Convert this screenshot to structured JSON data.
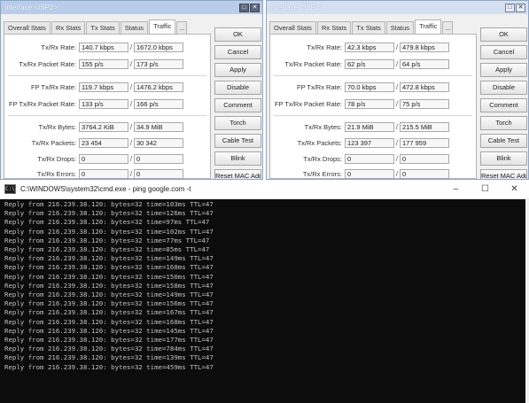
{
  "left_window": {
    "title": "Interface <ISP2>",
    "tabs": [
      "Overall Stats",
      "Rx Stats",
      "Tx Stats",
      "Status",
      "Traffic",
      "..."
    ],
    "active_tab": "Traffic",
    "rows": [
      {
        "label": "Tx/Rx Rate:",
        "v1": "140.7 kbps",
        "v2": "1672.0 kbps"
      },
      {
        "label": "Tx/Rx Packet Rate:",
        "v1": "155 p/s",
        "v2": "173 p/s"
      },
      {
        "label": "FP Tx/Rx Rate:",
        "v1": "119.7 kbps",
        "v2": "1476.2 kbps"
      },
      {
        "label": "FP Tx/Rx Packet Rate:",
        "v1": "133 p/s",
        "v2": "166 p/s"
      },
      {
        "label": "Tx/Rx Bytes:",
        "v1": "3764.2 KiB",
        "v2": "34.9 MiB"
      },
      {
        "label": "Tx/Rx Packets:",
        "v1": "23 454",
        "v2": "30 342"
      },
      {
        "label": "Tx/Rx Drops:",
        "v1": "0",
        "v2": "0"
      },
      {
        "label": "Tx/Rx Errors:",
        "v1": "0",
        "v2": "0"
      }
    ],
    "buttons": [
      "OK",
      "Cancel",
      "Apply",
      "Disable",
      "Comment",
      "Torch",
      "Cable Test",
      "Blink",
      "Reset MAC Address"
    ]
  },
  "right_window": {
    "title": "Interface <ISP1>",
    "tabs": [
      "Overall Stats",
      "Rx Stats",
      "Tx Stats",
      "Status",
      "Traffic",
      "..."
    ],
    "active_tab": "Traffic",
    "rows": [
      {
        "label": "Tx/Rx Rate:",
        "v1": "42.3 kbps",
        "v2": "479.8 kbps"
      },
      {
        "label": "Tx/Rx Packet Rate:",
        "v1": "62 p/s",
        "v2": "64 p/s"
      },
      {
        "label": "FP Tx/Rx Rate:",
        "v1": "70.0 kbps",
        "v2": "472.8 kbps"
      },
      {
        "label": "FP Tx/Rx Packet Rate:",
        "v1": "78 p/s",
        "v2": "75 p/s"
      },
      {
        "label": "Tx/Rx Bytes:",
        "v1": "21.9 MiB",
        "v2": "215.5 MiB"
      },
      {
        "label": "Tx/Rx Packets:",
        "v1": "123 397",
        "v2": "177 959"
      },
      {
        "label": "Tx/Rx Drops:",
        "v1": "0",
        "v2": "0"
      },
      {
        "label": "Tx/Rx Errors:",
        "v1": "0",
        "v2": "0"
      }
    ],
    "buttons": [
      "OK",
      "Cancel",
      "Apply",
      "Disable",
      "Comment",
      "Torch",
      "Cable Test",
      "Blink",
      "Reset MAC Address"
    ]
  },
  "cmd": {
    "title": "C:\\WINDOWS\\system32\\cmd.exe - ping google.com -t",
    "icon_text": "C:\\",
    "controls": [
      "–",
      "☐",
      "✕"
    ],
    "lines": [
      "Reply from 216.239.38.120: bytes=32 time=103ms TTL=47",
      "Reply from 216.239.38.120: bytes=32 time=126ms TTL=47",
      "Reply from 216.239.38.120: bytes=32 time=97ms TTL=47",
      "Reply from 216.239.38.120: bytes=32 time=102ms TTL=47",
      "Reply from 216.239.38.120: bytes=32 time=77ms TTL=47",
      "Reply from 216.239.38.120: bytes=32 time=85ms TTL=47",
      "Reply from 216.239.38.120: bytes=32 time=149ms TTL=47",
      "Reply from 216.239.38.120: bytes=32 time=168ms TTL=47",
      "Reply from 216.239.38.120: bytes=32 time=150ms TTL=47",
      "Reply from 216.239.38.120: bytes=32 time=158ms TTL=47",
      "Reply from 216.239.38.120: bytes=32 time=149ms TTL=47",
      "Reply from 216.239.38.120: bytes=32 time=156ms TTL=47",
      "Reply from 216.239.38.120: bytes=32 time=167ms TTL=47",
      "Reply from 216.239.38.120: bytes=32 time=168ms TTL=47",
      "Reply from 216.239.38.120: bytes=32 time=145ms TTL=47",
      "Reply from 216.239.38.120: bytes=32 time=177ms TTL=47",
      "Reply from 216.239.38.120: bytes=32 time=784ms TTL=47",
      "Reply from 216.239.38.120: bytes=32 time=139ms TTL=47",
      "Reply from 216.239.38.120: bytes=32 time=459ms TTL=47"
    ]
  }
}
